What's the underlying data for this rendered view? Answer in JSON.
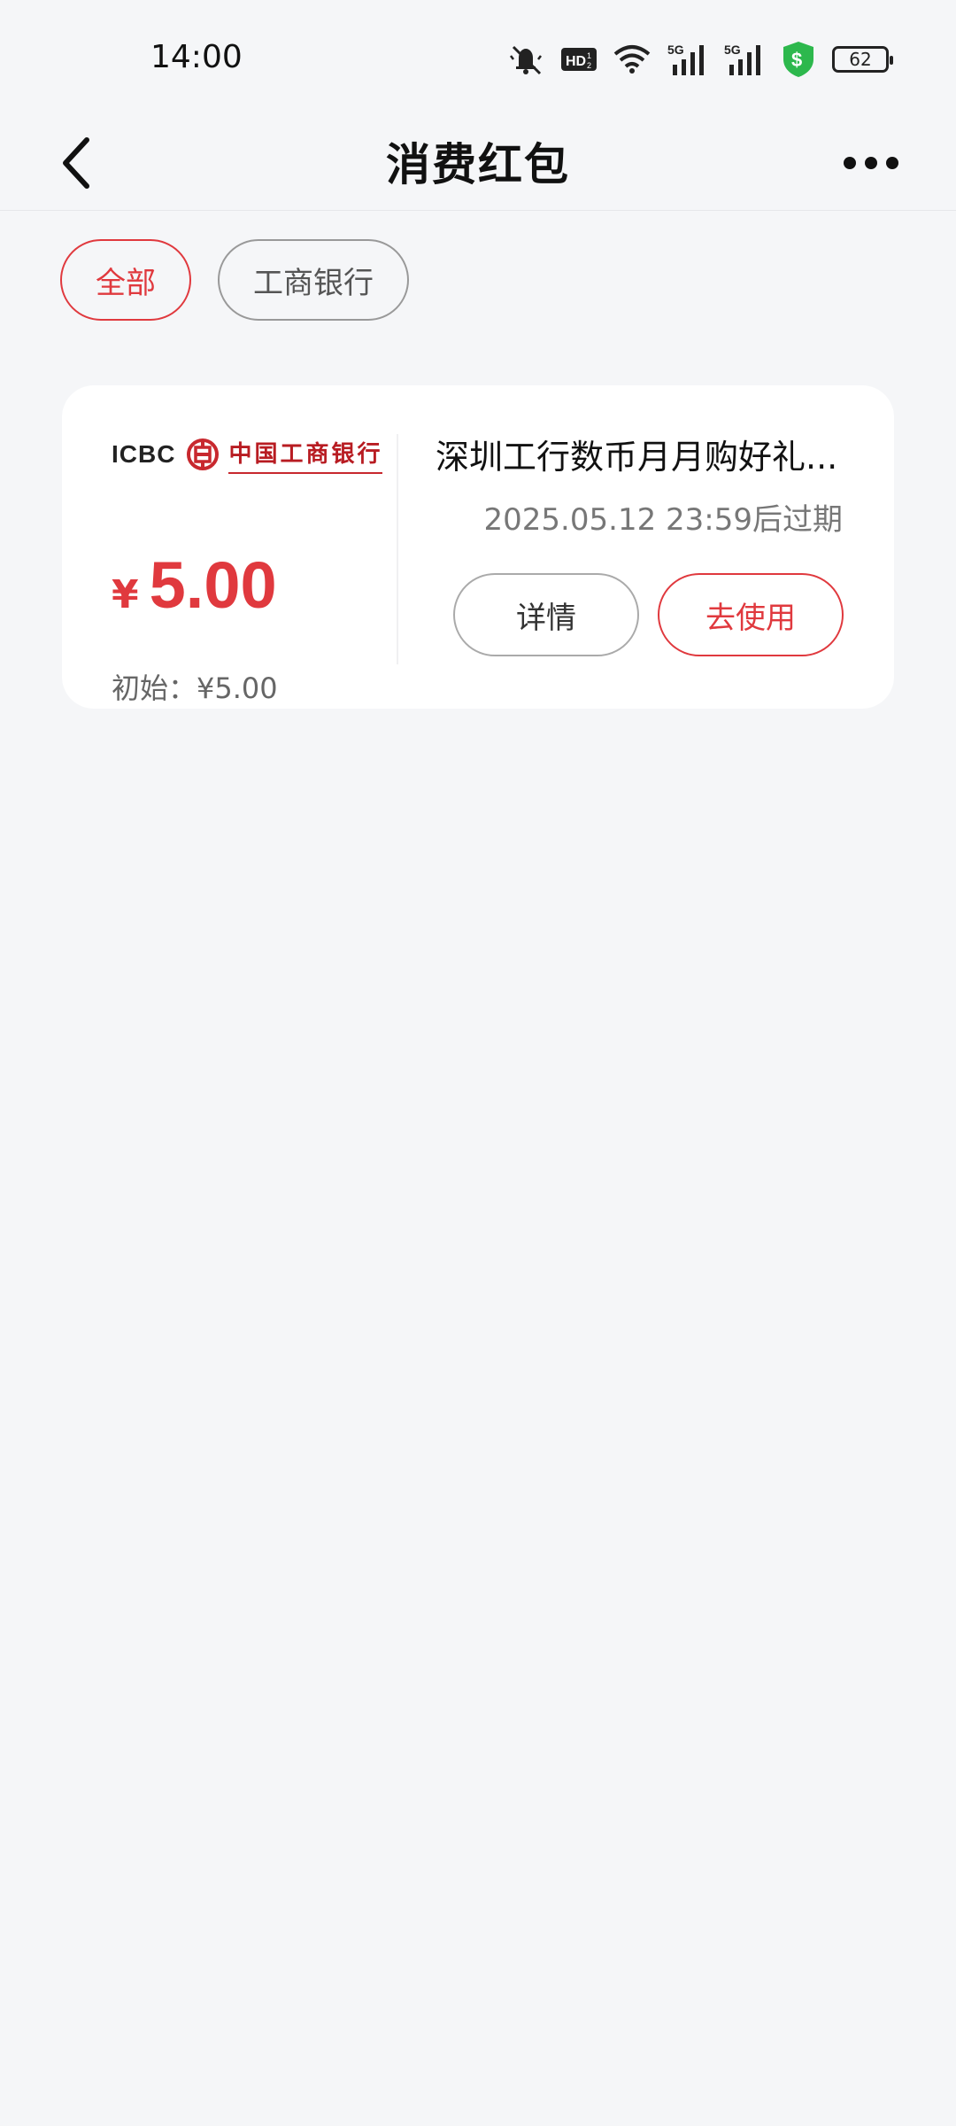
{
  "status_bar": {
    "time": "14:00",
    "network": "5G",
    "battery": "62",
    "icons": [
      "mute-bell-icon",
      "hd-icon",
      "wifi-icon",
      "signal-5g-icon",
      "signal-5g-icon",
      "payment-shield-icon",
      "battery-icon"
    ]
  },
  "header": {
    "title": "消费红包",
    "back_icon": "chevron-left-icon",
    "more_icon": "more-dots-icon"
  },
  "filters": [
    {
      "label": "全部",
      "active": true
    },
    {
      "label": "工商银行",
      "active": false
    }
  ],
  "card": {
    "logo_en": "ICBC",
    "logo_cn": "中国工商银行",
    "currency": "¥",
    "amount": "5.00",
    "initial": "初始：¥5.00",
    "title": "深圳工行数币月月购好礼...",
    "expire": "2025.05.12 23:59后过期",
    "detail_label": "详情",
    "use_label": "去使用"
  },
  "colors": {
    "accent": "#e0393e",
    "background": "#f5f6f8",
    "card": "#ffffff",
    "shield_green": "#2db84d"
  }
}
